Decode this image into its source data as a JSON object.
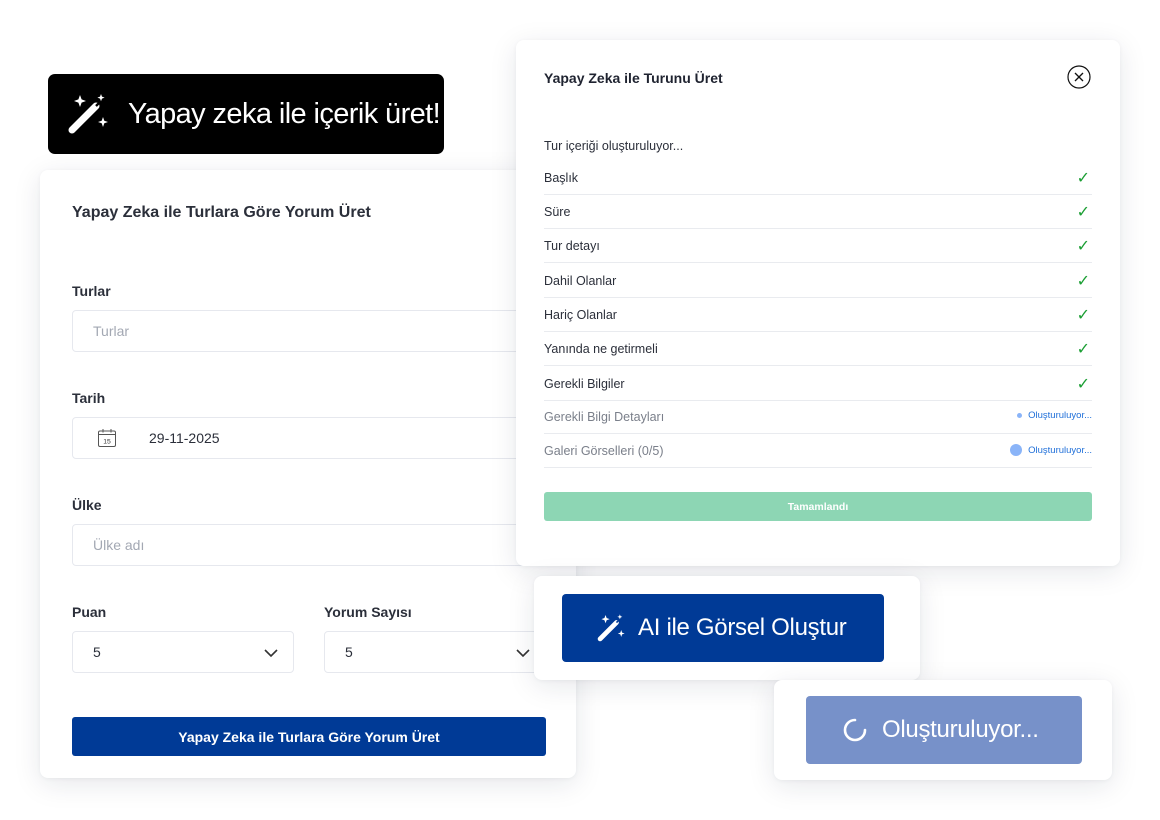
{
  "ai_banner": {
    "label": "Yapay zeka ile içerik üret!"
  },
  "review_form": {
    "title": "Yapay Zeka ile Turlara Göre Yorum Üret",
    "tours": {
      "label": "Turlar",
      "placeholder": "Turlar"
    },
    "date": {
      "label": "Tarih",
      "value": "29-11-2025",
      "calendar_day": "15"
    },
    "country": {
      "label": "Ülke",
      "placeholder": "Ülke adı"
    },
    "rating": {
      "label": "Puan",
      "value": "5"
    },
    "review_count": {
      "label": "Yorum Sayısı",
      "value": "5"
    },
    "submit_label": "Yapay Zeka ile Turlara Göre Yorum Üret"
  },
  "tour_modal": {
    "title": "Yapay Zeka ile Turunu Üret",
    "subtitle": "Tur içeriği oluşturuluyor...",
    "steps": [
      {
        "label": "Başlık",
        "status": "done"
      },
      {
        "label": "Süre",
        "status": "done"
      },
      {
        "label": "Tur detayı",
        "status": "done"
      },
      {
        "label": "Dahil Olanlar",
        "status": "done"
      },
      {
        "label": "Hariç Olanlar",
        "status": "done"
      },
      {
        "label": "Yanında ne getirmeli",
        "status": "done"
      },
      {
        "label": "Gerekli Bilgiler",
        "status": "done"
      },
      {
        "label": "Gerekli Bilgi Detayları",
        "status": "pending",
        "status_text": "Oluşturuluyor..."
      },
      {
        "label": "Galeri Görselleri (0/5)",
        "status": "pending",
        "status_text": "Oluşturuluyor..."
      }
    ],
    "done_label": "Tamamlandı"
  },
  "generate_image": {
    "label": "AI ile Görsel Oluştur"
  },
  "loading_button": {
    "label": "Oluşturuluyor..."
  },
  "colors": {
    "primary": "#003a96",
    "success": "#1a9e33",
    "done_button": "#8dd6b4",
    "loading_button": "#7791c9",
    "link_blue": "#1f6fd9"
  },
  "icons": {
    "ai_banner": "magic-wand-icon",
    "date": "calendar-icon",
    "close": "close-circle-icon",
    "select": "chevron-down-icon",
    "done_step": "check-icon",
    "loading": "spinner-icon"
  }
}
